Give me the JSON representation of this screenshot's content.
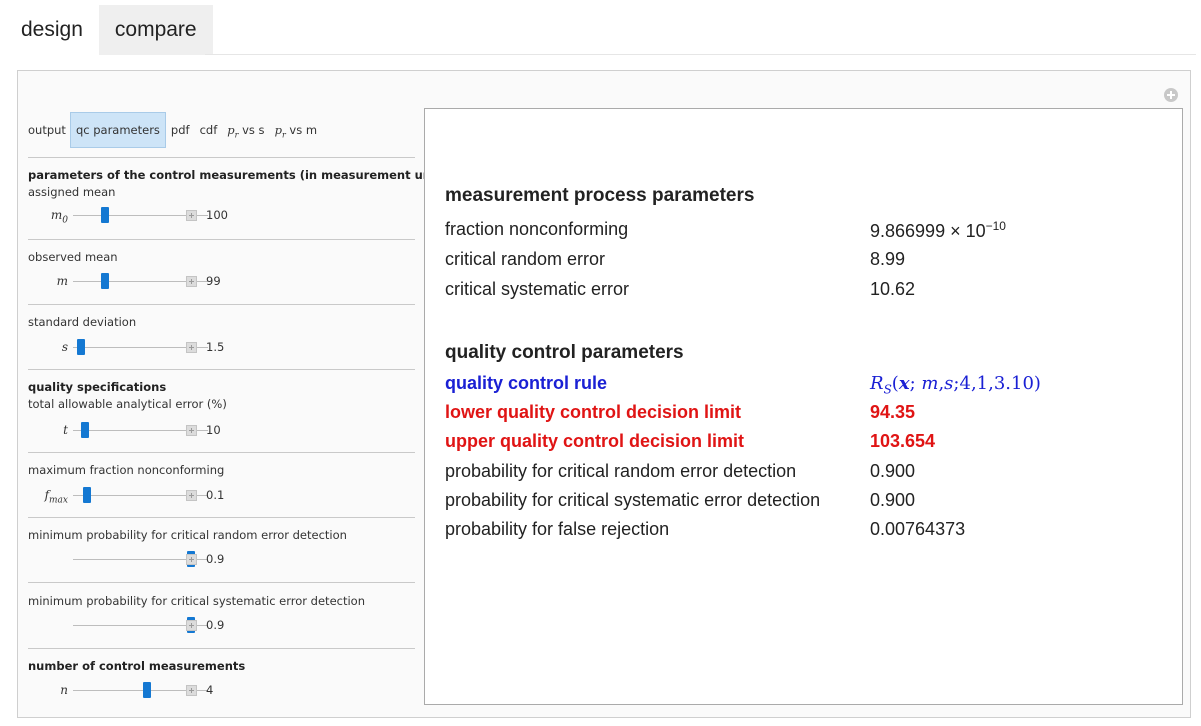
{
  "tabs": {
    "design": "design",
    "compare": "compare"
  },
  "output_selector": {
    "label": "output",
    "options": {
      "qc": "qc parameters",
      "pdf": "pdf",
      "cdf": "cdf",
      "pr_vs_s": "vs s",
      "pr_vs_m": "vs m"
    },
    "selected": "qc parameters"
  },
  "controls": {
    "section1_header": "parameters of the control measurements (in measurement units)",
    "assigned_mean": {
      "label": "assigned mean",
      "value": "100",
      "fraction": 0.22
    },
    "observed_mean": {
      "label": "observed mean",
      "value": "99",
      "fraction": 0.22
    },
    "standard_deviation": {
      "label": "standard deviation",
      "value": "1.5",
      "fraction": 0.03
    },
    "section2_header": "quality specifications",
    "total_allowable_error": {
      "label": "total allowable analytical error (%)",
      "value": "10",
      "fraction": 0.06
    },
    "max_fraction_nonconforming": {
      "label": "maximum fraction nonconforming",
      "value": "0.1",
      "fraction": 0.08
    },
    "min_prob_random": {
      "label": "minimum probability for critical random  error detection",
      "value": "0.9",
      "fraction": 0.9
    },
    "min_prob_systematic": {
      "label": "minimum probability for critical systematic error detection",
      "value": "0.9",
      "fraction": 0.9
    },
    "section3_header": "number of control measurements",
    "num_measurements": {
      "value": "4",
      "fraction": 0.55
    }
  },
  "output": {
    "process_header": "measurement process parameters",
    "fraction_nonconforming": {
      "label": "fraction nonconforming",
      "mantissa": "9.866999",
      "exponent": "−10"
    },
    "critical_random_error": {
      "label": "critical random error",
      "value": "8.99"
    },
    "critical_systematic_error": {
      "label": "critical systematic error",
      "value": "10.62"
    },
    "qc_header": "quality control parameters",
    "qc_rule": {
      "label": "quality control rule",
      "args": "4,1,3.10)"
    },
    "lower_limit": {
      "label": "lower quality control decision limit",
      "value": "94.35"
    },
    "upper_limit": {
      "label": "upper quality control decision limit",
      "value": "103.654"
    },
    "prob_random": {
      "label": "probability for critical random error detection",
      "value": "0.900"
    },
    "prob_systematic": {
      "label": "probability for critical systematic error detection",
      "value": "0.900"
    },
    "prob_false_rejection": {
      "label": "probability for false rejection",
      "value": "0.00764373"
    }
  },
  "colors": {
    "blue_accent": "#1a20d4",
    "red_accent": "#e01414",
    "slider_thumb": "#1478d2",
    "selected_option": "#cde4f7"
  }
}
